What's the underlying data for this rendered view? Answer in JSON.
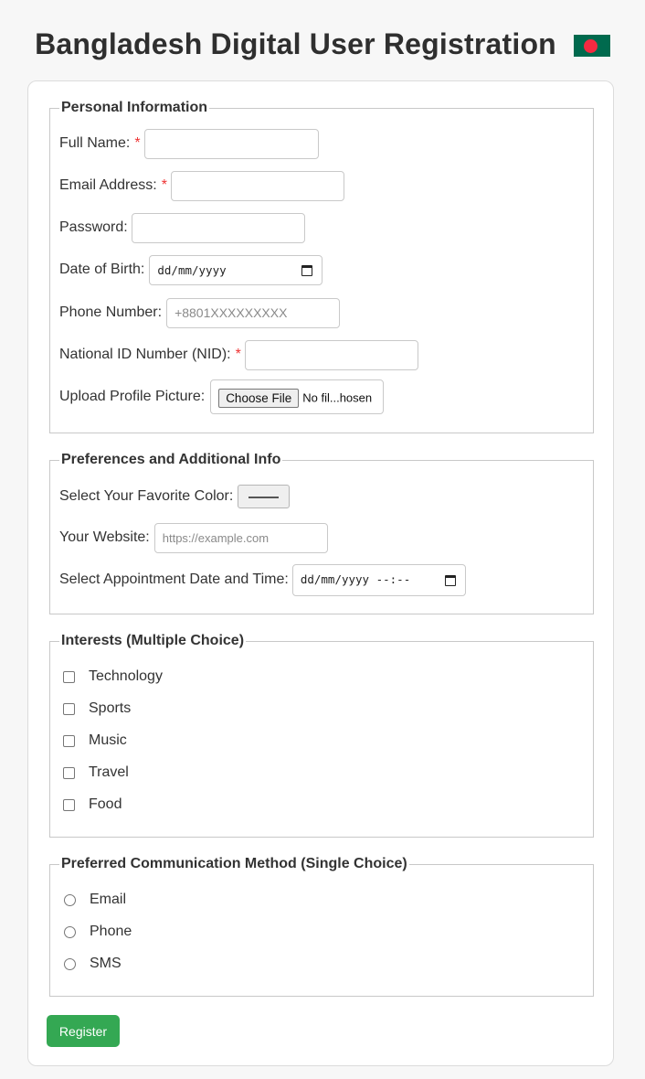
{
  "header": {
    "title": "Bangladesh Digital User Registration",
    "flag_icon": "bangladesh-flag-icon",
    "flag_colors": {
      "field": "#006a4e",
      "disc": "#f42a41"
    }
  },
  "personal": {
    "legend": "Personal Information",
    "full_name_label": "Full Name:",
    "full_name_value": "",
    "email_label": "Email Address:",
    "email_value": "",
    "password_label": "Password:",
    "password_value": "",
    "dob_label": "Date of Birth:",
    "dob_value": "dd/mm/yyyy",
    "phone_label": "Phone Number:",
    "phone_placeholder": "+8801XXXXXXXXX",
    "nid_label": "National ID Number (NID):",
    "nid_value": "",
    "picture_label": "Upload Profile Picture:",
    "file_button": "Choose File",
    "file_status": "No fil...hosen",
    "required_mark": "*"
  },
  "preferences": {
    "legend": "Preferences and Additional Info",
    "color_label": "Select Your Favorite Color:",
    "color_value": "#000000",
    "website_label": "Your Website:",
    "website_placeholder": "https://example.com",
    "appointment_label": "Select Appointment Date and Time:",
    "appointment_value": "dd/mm/yyyy --:--"
  },
  "interests": {
    "legend": "Interests (Multiple Choice)",
    "options": [
      "Technology",
      "Sports",
      "Music",
      "Travel",
      "Food"
    ]
  },
  "communication": {
    "legend": "Preferred Communication Method (Single Choice)",
    "options": [
      "Email",
      "Phone",
      "SMS"
    ]
  },
  "actions": {
    "register_label": "Register",
    "register_color": "#34a853"
  },
  "accent_colors": {
    "required": "#ee3333"
  }
}
